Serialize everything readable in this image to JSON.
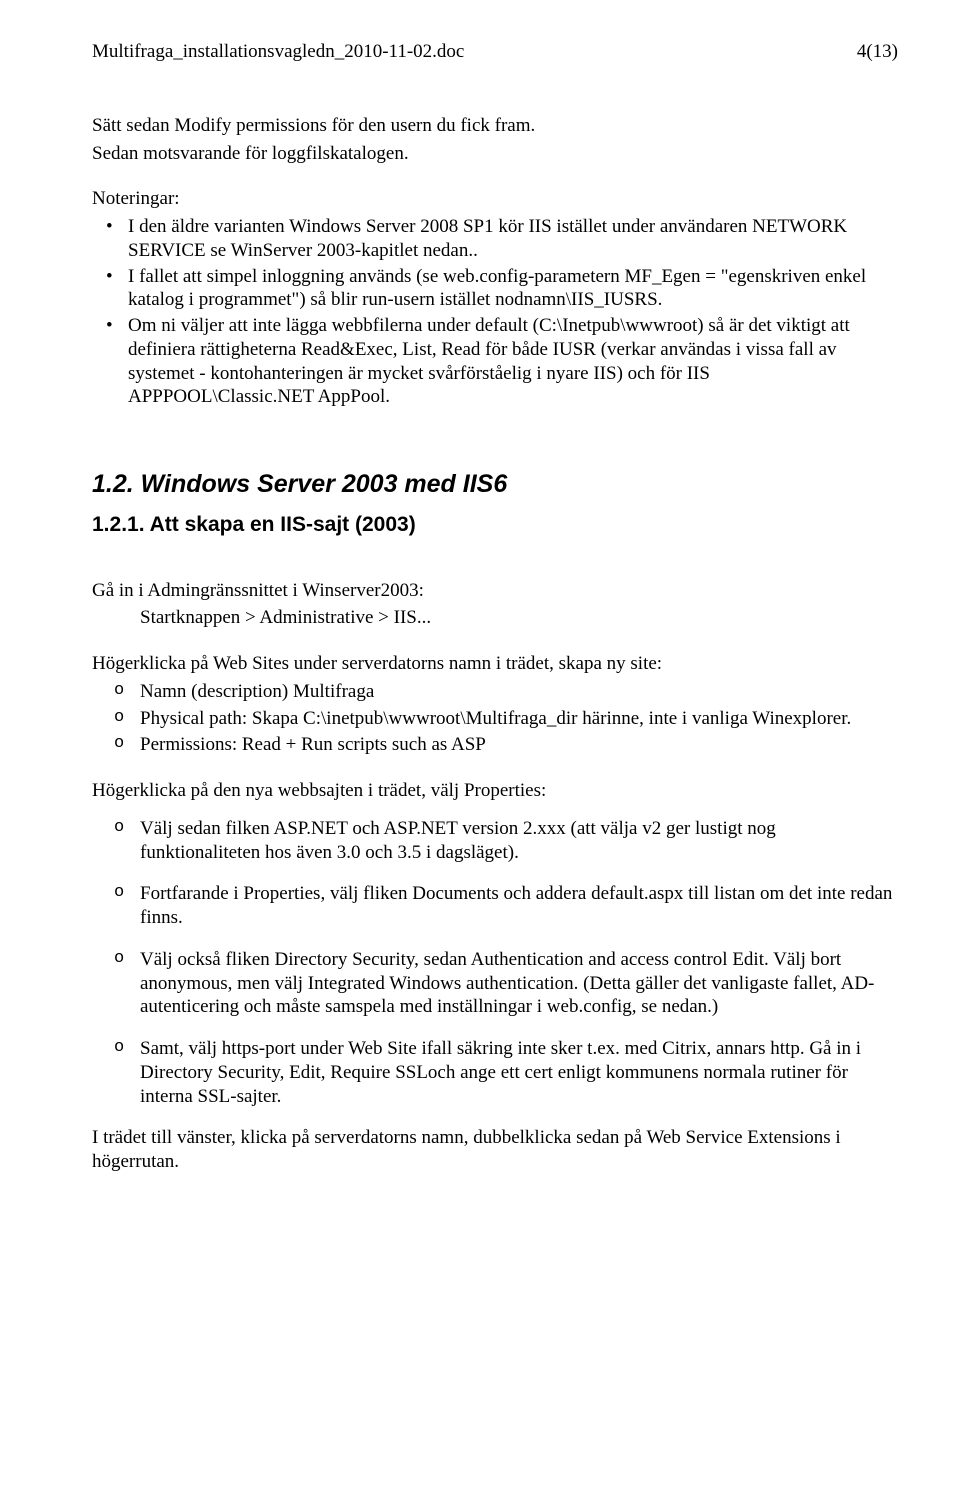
{
  "header": {
    "filename": "Multifraga_installationsvagledn_2010-11-02.doc",
    "page": "4(13)"
  },
  "intro": {
    "p1": "Sätt sedan Modify permissions för den usern du fick fram.",
    "p2": "Sedan motsvarande för loggfilskatalogen."
  },
  "noteringar": {
    "title": "Noteringar:",
    "items": [
      "I den äldre varianten Windows Server 2008 SP1 kör  IIS istället under användaren NETWORK SERVICE se WinServer 2003-kapitlet nedan..",
      "I fallet att simpel inloggning används (se web.config-parametern MF_Egen = \"egenskriven enkel katalog i programmet\") så blir run-usern istället nodnamn\\IIS_IUSRS.",
      "Om ni väljer att inte lägga webbfilerna under default (C:\\Inetpub\\wwwroot) så är det viktigt att definiera rättigheterna Read&Exec, List, Read för både IUSR (verkar användas i vissa fall av systemet - kontohanteringen är mycket svårförståelig i nyare IIS) och för IIS APPPOOL\\Classic.NET AppPool."
    ]
  },
  "section": {
    "h2": "1.2. Windows Server 2003 med IIS6",
    "h3": "1.2.1. Att skapa en IIS-sajt  (2003)"
  },
  "body": {
    "admin_intro": "Gå in i Admingränssnittet i Winserver2003:",
    "admin_path": "Startknappen > Administrative > IIS...",
    "websites_intro": "Högerklicka på Web Sites under serverdatorns namn i trädet, skapa ny site:",
    "websites_items": [
      "Namn (description) Multifraga",
      "Physical path: Skapa C:\\inetpub\\wwwroot\\Multifraga_dir härinne, inte i vanliga Winexplorer.",
      "Permissions: Read + Run scripts such as ASP"
    ],
    "props_intro": "Högerklicka på den nya webbsajten i trädet, välj Properties:",
    "props_items": [
      "Välj sedan filken ASP.NET och ASP.NET version 2.xxx (att välja v2 ger lustigt nog funktionaliteten hos även 3.0 och 3.5 i dagsläget).",
      "Fortfarande i Properties, välj fliken Documents och addera default.aspx till listan om det inte redan finns.",
      "Välj också fliken Directory Security, sedan Authentication and access control Edit. Välj bort anonymous, men välj Integrated Windows authentication. (Detta gäller det vanligaste fallet, AD-autenticering och måste samspela med inställningar i web.config, se nedan.)",
      "Samt, välj https-port under Web Site ifall säkring inte sker t.ex. med Citrix, annars http. Gå in i Directory Security, Edit, Require SSLoch ange ett cert enligt kommunens normala rutiner för interna SSL-sajter."
    ],
    "tree_outro": "I trädet till vänster, klicka på serverdatorns namn, dubbelklicka sedan på Web Service Extensions i högerrutan."
  }
}
